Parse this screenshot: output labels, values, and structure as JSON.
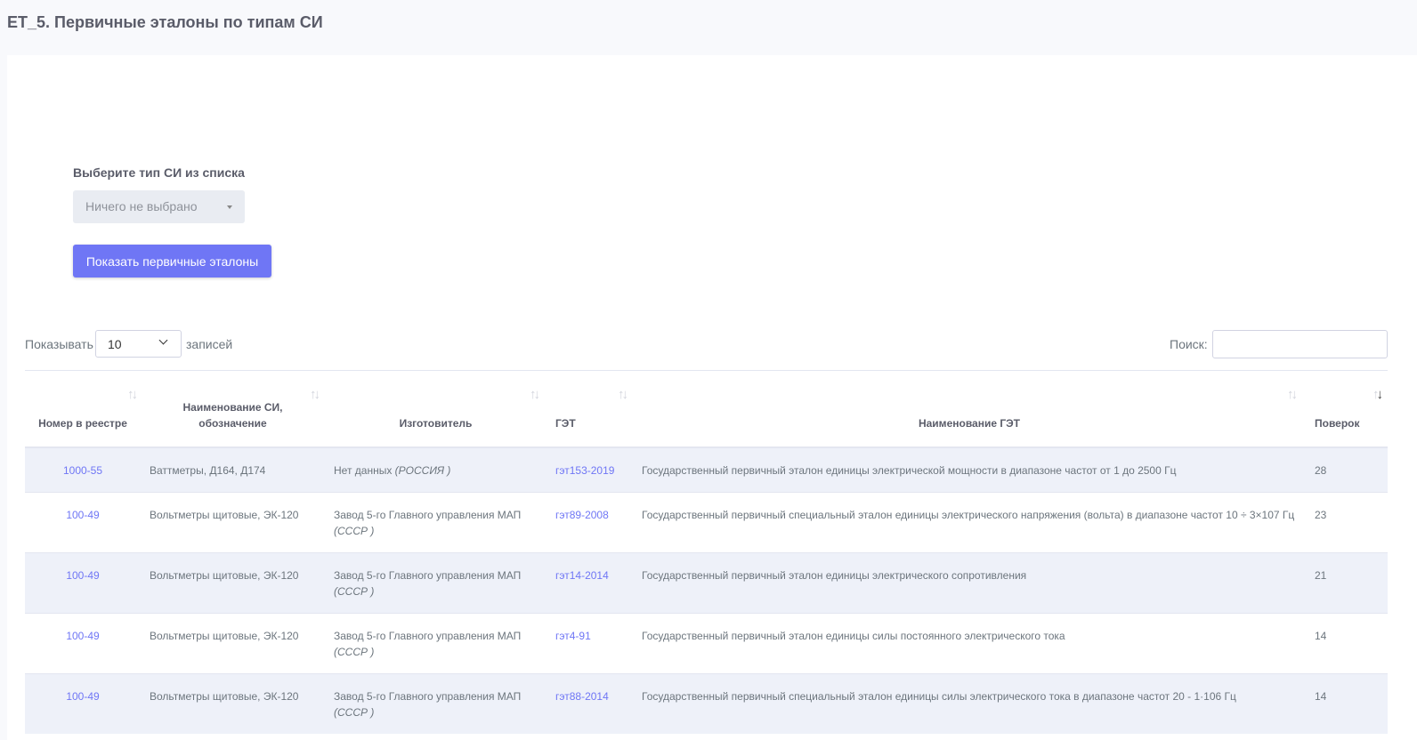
{
  "page": {
    "title": "ET_5. Первичные эталоны по типам СИ"
  },
  "filter": {
    "label": "Выберите тип СИ из списка",
    "select_value": "Ничего не выбрано",
    "button_label": "Показать первичные эталоны"
  },
  "table_controls": {
    "length_label": "Показывать",
    "length_value": "10",
    "length_suffix": "записей",
    "search_label": "Поиск:",
    "search_value": ""
  },
  "table": {
    "columns": [
      "Номер в реестре",
      "Наименование СИ, обозначение",
      "Изготовитель",
      "ГЭТ",
      "Наименование ГЭТ",
      "Поверок"
    ],
    "rows": [
      {
        "reg": "1000-55",
        "name": "Ваттметры, Д164, Д174",
        "maker": "Нет данных ",
        "country": "(РОССИЯ )",
        "get": "гэт153-2019",
        "get_name": "Государственный первичный эталон единицы электрической мощности в диапазоне частот от 1 до 2500 Гц",
        "count": "28"
      },
      {
        "reg": "100-49",
        "name": "Вольтметры щитовые, ЭК-120",
        "maker": "Завод 5-го Главного управления МАП ",
        "country": "(СССР )",
        "get": "гэт89-2008",
        "get_name": "Государственный первичный специальный эталон единицы электрического напряжения (вольта) в диапазоне частот 10 ÷ 3×107 Гц",
        "count": "23"
      },
      {
        "reg": "100-49",
        "name": "Вольтметры щитовые, ЭК-120",
        "maker": "Завод 5-го Главного управления МАП ",
        "country": "(СССР )",
        "get": "гэт14-2014",
        "get_name": "Государственный первичный эталон единицы электрического сопротивления",
        "count": "21"
      },
      {
        "reg": "100-49",
        "name": "Вольтметры щитовые, ЭК-120",
        "maker": "Завод 5-го Главного управления МАП ",
        "country": "(СССР )",
        "get": "гэт4-91",
        "get_name": "Государственный первичный эталон единицы силы постоянного электрического тока",
        "count": "14"
      },
      {
        "reg": "100-49",
        "name": "Вольтметры щитовые, ЭК-120",
        "maker": "Завод 5-го Главного управления МАП ",
        "country": "(СССР )",
        "get": "гэт88-2014",
        "get_name": "Государственный первичный специальный эталон единицы силы электрического тока в диапазоне частот 20 - 1·106 Гц",
        "count": "14"
      }
    ]
  },
  "colors": {
    "accent": "#6f76f5",
    "row_stripe": "#eef1f9",
    "page_bg": "#f8f9fc"
  }
}
